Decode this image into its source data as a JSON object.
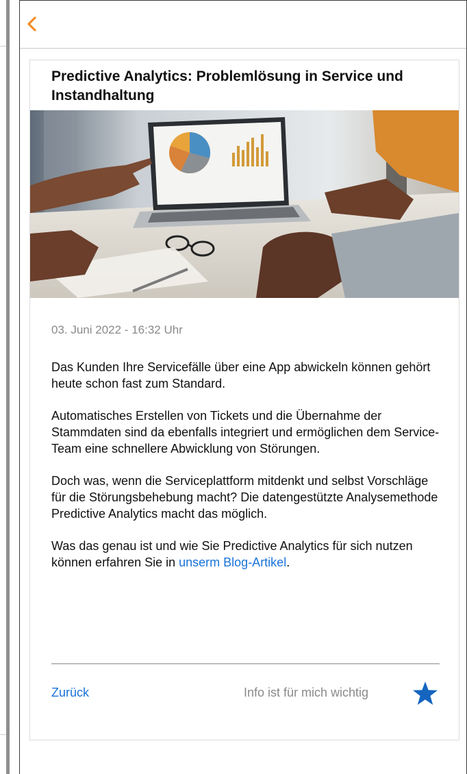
{
  "article": {
    "title": "Predictive Analytics: Problemlösung in Service und Instandhaltung",
    "date": "03. Juni 2022 - 16:32 Uhr",
    "paragraphs": [
      "Das Kunden Ihre Servicefälle über eine App abwickeln können gehört heute schon fast zum Standard.",
      "Automatisches Erstellen von Tickets und die Übernahme der Stammdaten sind da ebenfalls integriert und ermöglichen dem Service-Team eine schnellere Abwicklung von Störungen.",
      "Doch was, wenn die Serviceplattform mitdenkt und selbst Vorschläge für die Störungsbehebung macht? Die datengestützte Analysemethode Predictive Analytics macht das möglich."
    ],
    "last_paragraph_prefix": "Was das genau ist und wie Sie Predictive Analytics für sich nutzen können erfahren Sie in ",
    "blog_link_text": "unserm Blog-Artikel",
    "last_paragraph_suffix": "."
  },
  "footer": {
    "back_label": "Zurück",
    "important_label": "Info ist für mich wichtig"
  },
  "icons": {
    "back": "chevron-left-icon",
    "favorite": "star-icon"
  },
  "colors": {
    "accent_orange": "#f28c28",
    "link_blue": "#1a73d9",
    "star_blue": "#1565c0"
  }
}
